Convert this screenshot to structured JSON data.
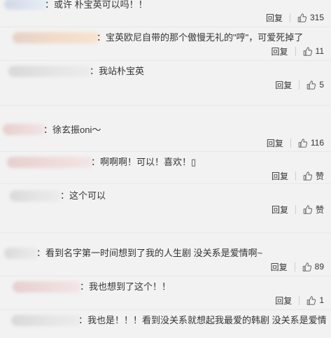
{
  "comments": [
    {
      "text": "：或许 朴宝英可以吗！！",
      "reply": "回复",
      "likes": "315"
    },
    {
      "text": "：宝英欧尼自带的那个傲慢无礼的\"哼\"，可爱死掉了",
      "reply": "回复",
      "likes": "11"
    },
    {
      "text": "：我站朴宝英",
      "reply": "回复",
      "likes": "5"
    },
    {
      "text": "：徐玄振oni～",
      "reply": "回复",
      "likes": "116"
    },
    {
      "text": "：啊啊啊！可以！喜欢！▯",
      "reply": "回复",
      "likes": "赞"
    },
    {
      "text": "：这个可以",
      "reply": "回复",
      "likes": "赞"
    },
    {
      "text": "：看到名字第一时间想到了我的人生剧 没关系是爱情啊~",
      "reply": "回复",
      "likes": "89"
    },
    {
      "text": "：我也想到了这个！！",
      "reply": "回复",
      "likes": "1"
    },
    {
      "text": "：我也是！！！看到没关系就想起我最爱的韩剧 没关系是爱情",
      "reply": "",
      "likes": ""
    }
  ]
}
